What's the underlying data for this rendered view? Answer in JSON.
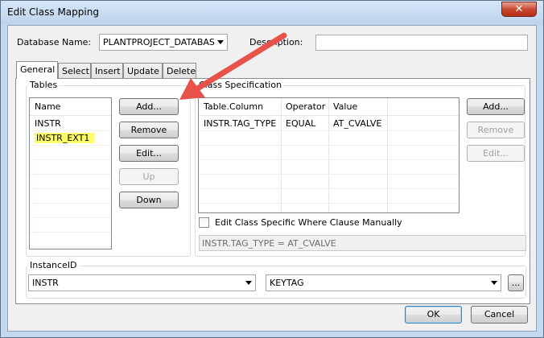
{
  "window": {
    "title": "Edit Class Mapping",
    "close_glyph": "✕"
  },
  "database": {
    "label": "Database Name:",
    "value": "PLANTPROJECT_DATABAS",
    "description_label": "Description:",
    "description_value": ""
  },
  "tabs": [
    {
      "label": "General"
    },
    {
      "label": "Select"
    },
    {
      "label": "Insert"
    },
    {
      "label": "Update"
    },
    {
      "label": "Delete"
    }
  ],
  "tables": {
    "group_label": "Tables",
    "column_header": "Name",
    "rows": [
      "INSTR",
      "INSTR_EXT1"
    ],
    "highlight_color": "#ffff66",
    "buttons": {
      "add": "Add...",
      "remove": "Remove",
      "edit": "Edit...",
      "up": "Up",
      "down": "Down"
    }
  },
  "class_spec": {
    "group_label": "Class Specification",
    "columns": [
      "Table.Column",
      "Operator",
      "Value"
    ],
    "rows": [
      {
        "column": "INSTR.TAG_TYPE",
        "operator": "EQUAL",
        "value": "AT_CVALVE"
      }
    ],
    "buttons": {
      "add": "Add...",
      "remove": "Remove",
      "edit": "Edit..."
    },
    "manual_checkbox_label": "Edit Class Specific Where Clause Manually",
    "manual_checked": false,
    "where_clause": "INSTR.TAG_TYPE = AT_CVALVE"
  },
  "instance_id": {
    "group_label": "InstanceID",
    "table_value": "INSTR",
    "column_value": "KEYTAG",
    "browse_label": "..."
  },
  "footer": {
    "ok": "OK",
    "cancel": "Cancel"
  },
  "annotation": {
    "arrow_color": "#e8524a"
  }
}
